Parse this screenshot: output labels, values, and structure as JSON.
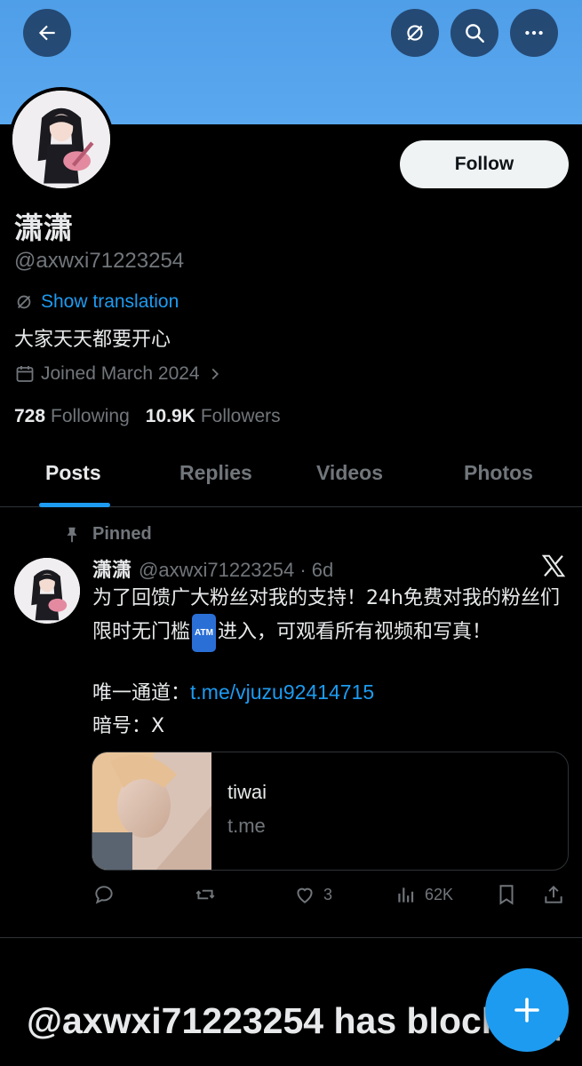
{
  "profile": {
    "display_name": "潇潇",
    "handle": "@axwxi71223254",
    "show_translation": "Show translation",
    "bio": "大家天天都要开心",
    "joined": "Joined March 2024",
    "following_count": "728",
    "following_label": "Following",
    "followers_count": "10.9K",
    "followers_label": "Followers",
    "follow_label": "Follow"
  },
  "tabs": [
    {
      "label": "Posts",
      "active": true
    },
    {
      "label": "Replies",
      "active": false
    },
    {
      "label": "Videos",
      "active": false
    },
    {
      "label": "Photos",
      "active": false
    }
  ],
  "tweet": {
    "pinned_label": "Pinned",
    "name": "潇潇",
    "handle_time": "@axwxi71223254 · 6d",
    "text_part1": "为了回馈广大粉丝对我的支持！24h免费对我的粉丝们限时无门槛",
    "atm_emoji": "ATM",
    "text_part2": "进入，可观看所有视频和写真！",
    "channel_label": "唯一通道：",
    "channel_url": "t.me/vjuzu92414715",
    "code_line": "暗号：X",
    "card_title": "tiwai",
    "card_domain": "t.me",
    "likes": "3",
    "views": "62K"
  },
  "blocked_notice": "@axwxi71223254 has blocked you",
  "colors": {
    "banner": "#5aa8ef",
    "accent": "#1d9bf0",
    "secondary_text": "#71767b",
    "border": "#2f3336"
  },
  "icons": [
    "back-arrow-icon",
    "translate-icon",
    "search-icon",
    "more-icon",
    "calendar-icon",
    "chevron-right-icon",
    "pin-icon",
    "x-logo-icon",
    "reply-icon",
    "retweet-icon",
    "like-icon",
    "views-icon",
    "bookmark-icon",
    "share-icon",
    "plus-icon"
  ]
}
